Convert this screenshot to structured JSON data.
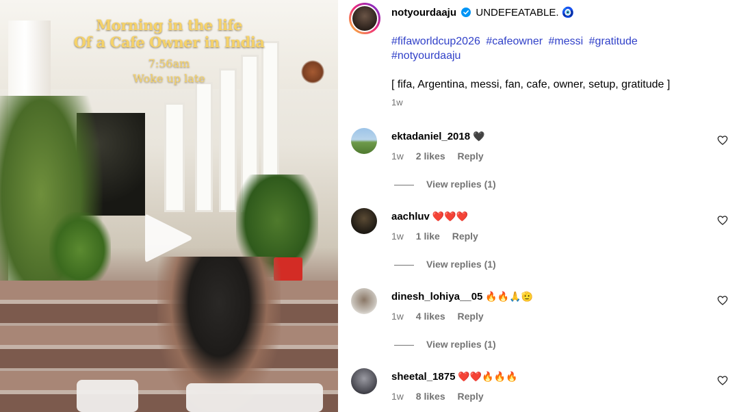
{
  "video": {
    "overlay_title_line1": "Morning in the life",
    "overlay_title_line2": "Of a Cafe Owner in India",
    "overlay_time": "7:56am",
    "overlay_sub": "Woke up late",
    "play_icon": "play-icon"
  },
  "post": {
    "username": "notyourdaaju",
    "verified_icon": "verified-badge-icon",
    "caption_text": "UNDEFEATABLE. 🧿",
    "hashtags": [
      "#fifaworldcup2026",
      "#cafeowner",
      "#messi",
      "#gratitude",
      "#notyourdaaju"
    ],
    "tags_line": "[ fifa, Argentina, messi, fan, cafe, owner, setup, gratitude ]",
    "time": "1w"
  },
  "comments": [
    {
      "username": "ektadaniel_2018",
      "emoji": "🖤",
      "time": "1w",
      "likes": "2 likes",
      "reply": "Reply",
      "view_replies": "View replies (1)"
    },
    {
      "username": "aachluv",
      "emoji": "❤️❤️❤️",
      "time": "1w",
      "likes": "1 like",
      "reply": "Reply",
      "view_replies": "View replies (1)"
    },
    {
      "username": "dinesh_lohiya__05",
      "emoji": "🔥🔥🙏🫡",
      "time": "1w",
      "likes": "4 likes",
      "reply": "Reply",
      "view_replies": "View replies (1)"
    },
    {
      "username": "sheetal_1875",
      "emoji": "❤️❤️🔥🔥🔥",
      "time": "1w",
      "likes": "8 likes",
      "reply": "Reply"
    }
  ],
  "colors": {
    "hashtag": "#3040c8",
    "muted": "#737373",
    "overlay_text": "#f5d26a"
  }
}
